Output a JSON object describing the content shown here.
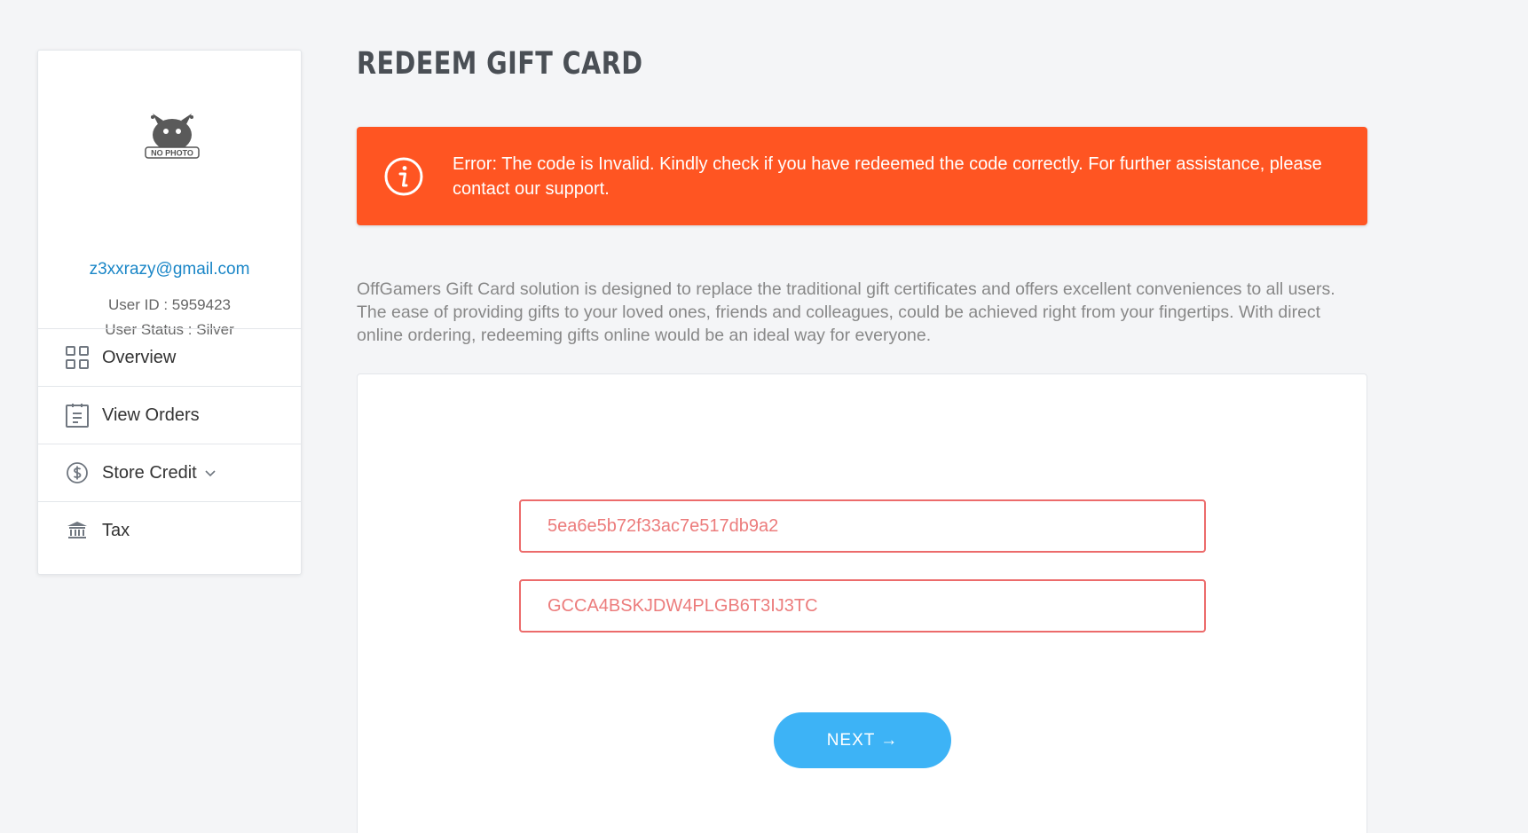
{
  "page": {
    "title": "REDEEM GIFT CARD"
  },
  "profile": {
    "avatar_caption": "NO PHOTO",
    "email": "z3xxrazy@gmail.com",
    "user_id": "User ID : 5959423",
    "user_status": "User Status : Silver"
  },
  "sidebar": {
    "items": [
      {
        "label": "Overview",
        "icon": "grid-icon"
      },
      {
        "label": "View Orders",
        "icon": "clipboard-icon"
      },
      {
        "label": "Store Credit",
        "icon": "dollar-circle-icon",
        "has_dropdown": true
      },
      {
        "label": "Tax",
        "icon": "bank-icon"
      }
    ]
  },
  "alert": {
    "icon": "info-icon",
    "message": "Error: The code is Invalid. Kindly check if you have redeemed the code correctly. For further assistance, please contact our support.",
    "color": "#ff5522"
  },
  "description": "OffGamers Gift Card solution is designed to replace the traditional gift certificates and offers excellent conveniences to all users. The ease of providing gifts to your loved ones, friends and colleagues, could be achieved right from your fingertips. With direct online ordering, redeeming gifts online would be an ideal way for everyone.",
  "form": {
    "serial_value": "5ea6e5b72f33ac7e517db9a2",
    "pin_value": "GCCA4BSKJDW4PLGB6T3IJ3TC",
    "next_label": "NEXT →",
    "error_color": "#ec6b6b",
    "button_color": "#3db3f6"
  }
}
